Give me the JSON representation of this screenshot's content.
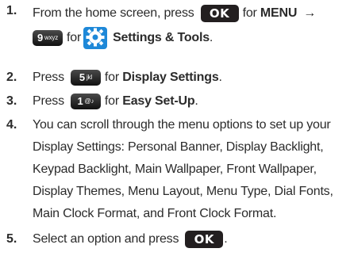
{
  "steps": [
    {
      "num": "1.",
      "p1": "From the home screen, press",
      "k1": "OK",
      "p2": "for",
      "menu": "MENU",
      "arrow": "→",
      "k2_digit": "9",
      "k2_letters": "wxyz",
      "p3": "for",
      "icon": "settings-tools-gear-icon",
      "settings": "Settings & Tools",
      "p4": "."
    },
    {
      "num": "2.",
      "p1": "Press",
      "k_digit": "5",
      "k_letters": "jkl",
      "p2": "for",
      "bold": "Display Settings",
      "p3": "."
    },
    {
      "num": "3.",
      "p1": "Press",
      "k_digit": "1",
      "k_letters": "@♪",
      "p2": "for",
      "bold": "Easy Set-Up",
      "p3": "."
    },
    {
      "num": "4.",
      "lines": [
        "You can scroll through the menu options to set up your",
        "Display Settings: Personal Banner, Display Backlight,",
        "Keypad Backlight, Main Wallpaper, Front Wallpaper,",
        "Display Themes, Menu Layout, Menu Type, Dial Fonts,",
        "Main Clock Format, and Front Clock Format."
      ]
    },
    {
      "num": "5.",
      "p1": "Select an option and press",
      "k1": "OK",
      "p2": "."
    }
  ],
  "colors": {
    "text": "#2b2b2b",
    "key_bg": "#231f20",
    "key_text": "#ffffff",
    "gear_blue": "#1e88d8"
  }
}
